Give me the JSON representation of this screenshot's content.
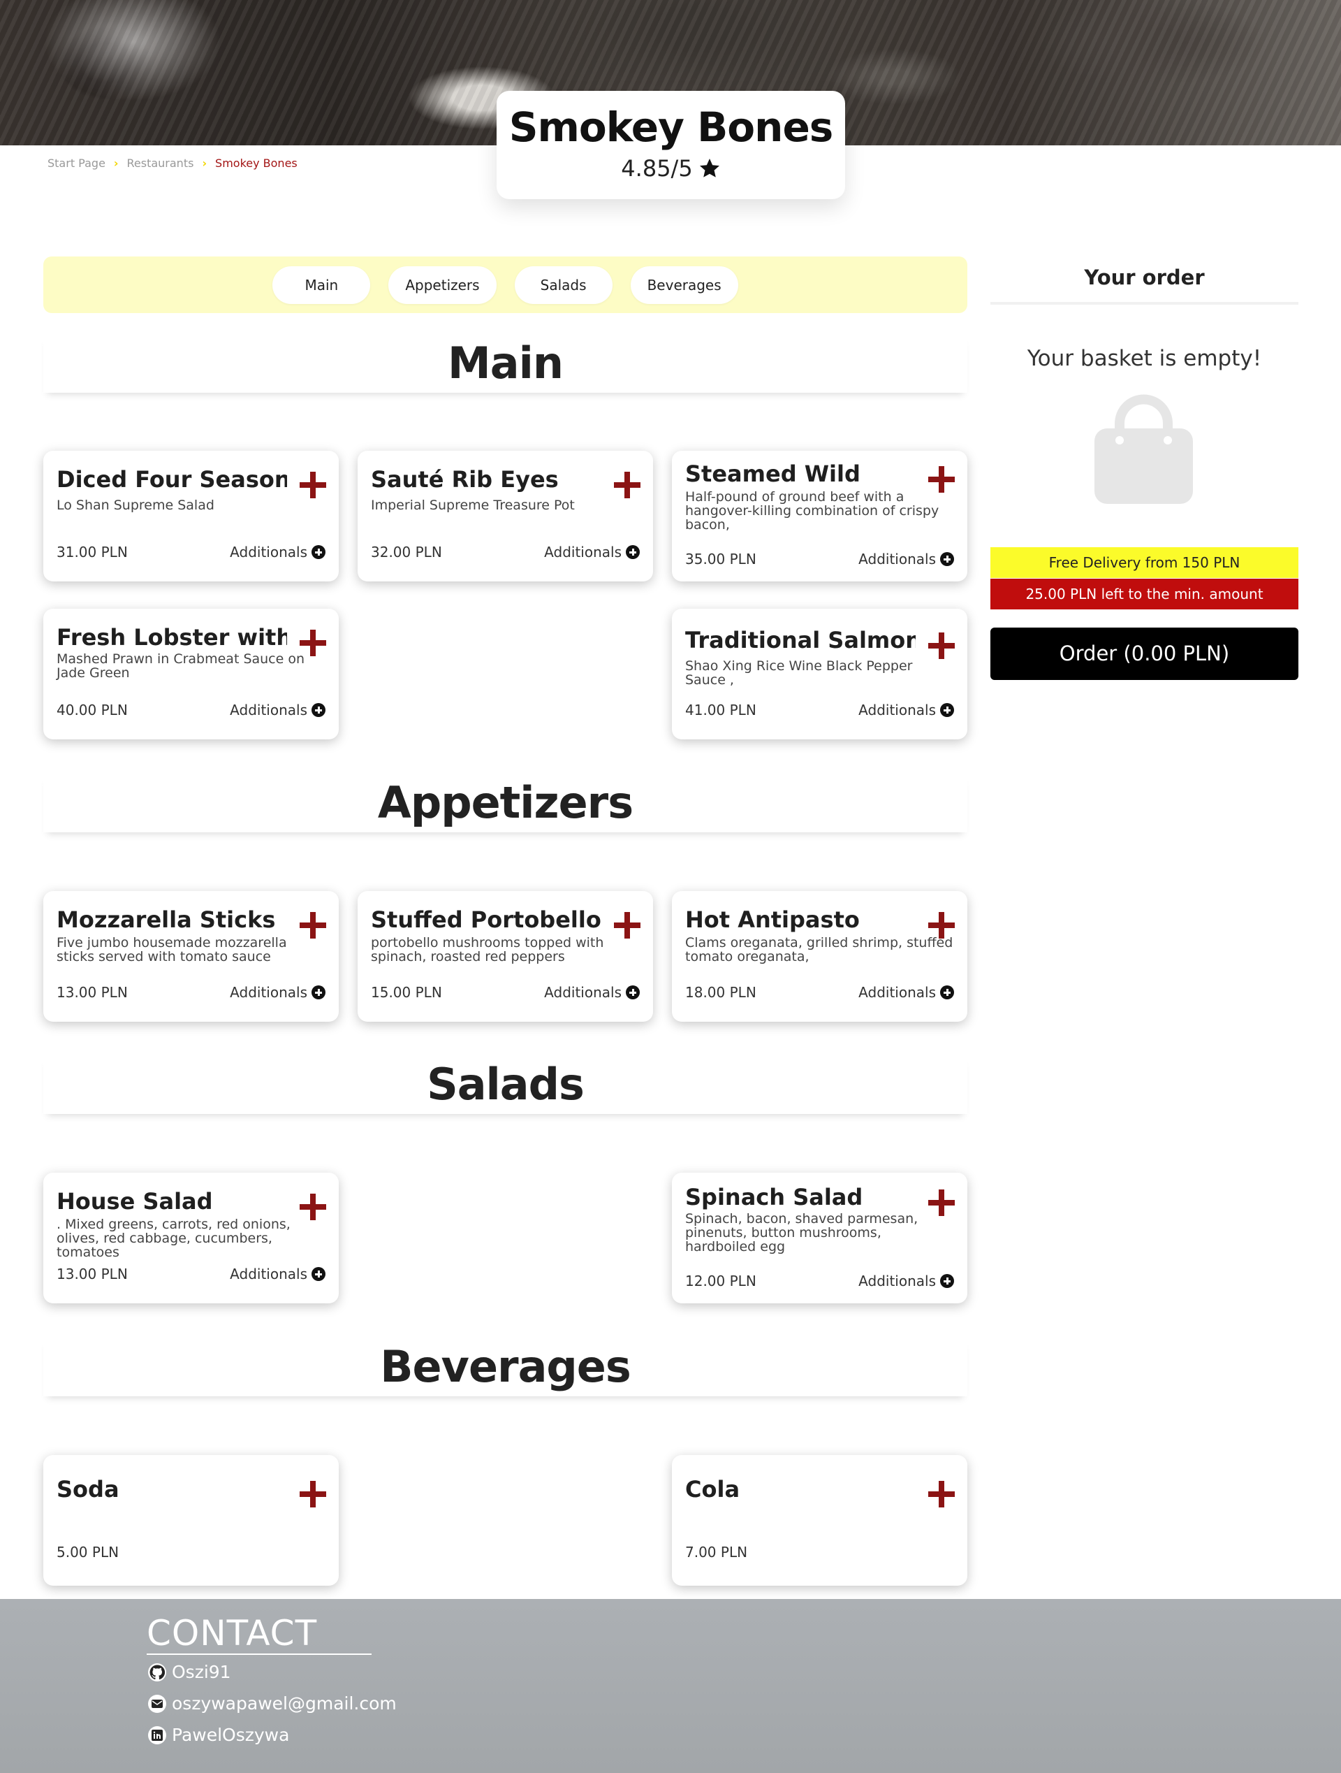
{
  "restaurant": {
    "name": "Smokey Bones",
    "rating": "4.85/5"
  },
  "breadcrumb": {
    "items": [
      "Start Page",
      "Restaurants",
      "Smokey Bones"
    ]
  },
  "tabs": [
    "Main",
    "Appetizers",
    "Salads",
    "Beverages"
  ],
  "sections": {
    "main": {
      "title": "Main",
      "items": [
        {
          "name": "Diced Four Season",
          "desc": "Lo Shan Supreme Salad",
          "price": "31.00 PLN",
          "additionals": "Additionals"
        },
        {
          "name": "Sauté Rib Eyes",
          "desc": "Imperial Supreme Treasure Pot",
          "price": "32.00 PLN",
          "additionals": "Additionals"
        },
        {
          "name": "Steamed Wild",
          "desc": "Half-pound of ground beef with a hangover-killing combination of crispy bacon,",
          "price": "35.00 PLN",
          "additionals": "Additionals"
        },
        {
          "name": "Fresh Lobster with",
          "desc": "Mashed Prawn in Crabmeat Sauce on Jade Green",
          "price": "40.00 PLN",
          "additionals": "Additionals"
        },
        {
          "name": "Traditional Salmon",
          "desc": "Shao Xing Rice Wine Black Pepper Sauce ,",
          "price": "41.00 PLN",
          "additionals": "Additionals"
        }
      ]
    },
    "appetizers": {
      "title": "Appetizers",
      "items": [
        {
          "name": "Mozzarella Sticks",
          "desc": "Five jumbo housemade mozzarella sticks served with tomato sauce",
          "price": "13.00 PLN",
          "additionals": "Additionals"
        },
        {
          "name": "Stuffed Portobello",
          "desc": "portobello mushrooms topped with spinach, roasted red peppers",
          "price": "15.00 PLN",
          "additionals": "Additionals"
        },
        {
          "name": "Hot Antipasto",
          "desc": "Clams oreganata, grilled shrimp, stuffed tomato oreganata,",
          "price": "18.00 PLN",
          "additionals": "Additionals"
        }
      ]
    },
    "salads": {
      "title": "Salads",
      "items": [
        {
          "name": "House Salad",
          "desc": ". Mixed greens, carrots, red onions, olives, red cabbage, cucumbers, tomatoes",
          "price": "13.00 PLN",
          "additionals": "Additionals"
        },
        {
          "name": "Spinach Salad",
          "desc": "Spinach, bacon, shaved parmesan, pinenuts, button mushrooms, hardboiled egg",
          "price": "12.00 PLN",
          "additionals": "Additionals"
        }
      ]
    },
    "beverages": {
      "title": "Beverages",
      "items": [
        {
          "name": "Soda",
          "desc": "",
          "price": "5.00 PLN"
        },
        {
          "name": "Cola",
          "desc": "",
          "price": "7.00 PLN"
        }
      ]
    }
  },
  "order": {
    "title": "Your order",
    "empty_text": "Your basket is empty!",
    "free_delivery": "Free Delivery from 150 PLN",
    "min_left": "25.00 PLN left to the min. amount",
    "button": "Order (0.00 PLN)"
  },
  "footer": {
    "title": "CONTACT",
    "github": "Oszi91",
    "email": "oszywapawel@gmail.com",
    "linkedin": "PawelOszywa"
  },
  "colors": {
    "accent_red": "#8b1414",
    "tabs_bg": "#fdfcc5",
    "free_delivery_bg": "#fbfb2a",
    "min_amount_bg": "#c00d0d"
  },
  "icons": [
    "star-icon",
    "chevron-right-icon",
    "plus-icon",
    "plus-circle-icon",
    "shopping-bag-icon",
    "github-icon",
    "envelope-icon",
    "linkedin-icon"
  ]
}
